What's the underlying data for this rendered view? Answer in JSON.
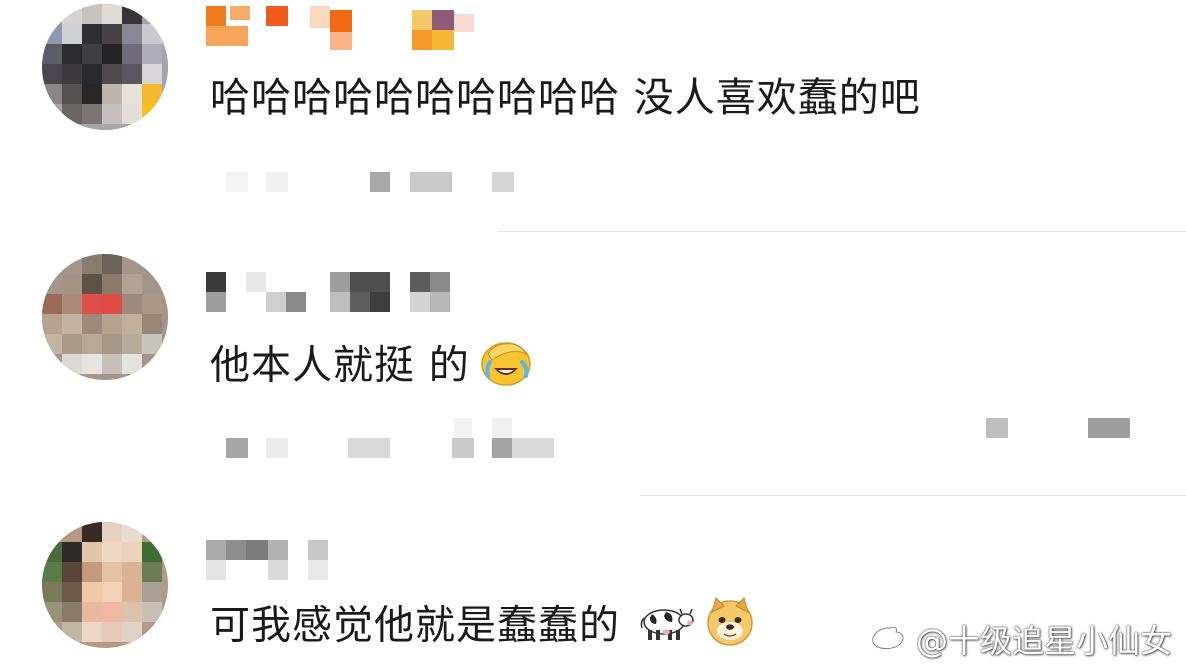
{
  "comments": [
    {
      "text": "哈哈哈哈哈哈哈哈哈哈 没人喜欢蠢的吧"
    },
    {
      "text": "他本人就挺 的",
      "emoji": "laughing-crying-emoji"
    },
    {
      "text": "可我感觉他就是蠢蠢的",
      "emoji": [
        "cow-emoji",
        "doge-emoji"
      ]
    }
  ],
  "watermark": {
    "text": "@十级追星小仙女",
    "logo": "weibo-logo-icon"
  },
  "colors": {
    "text": "#1a1a1a",
    "divider": "#e6e6e6",
    "accent_orange": "#f07a1e"
  }
}
